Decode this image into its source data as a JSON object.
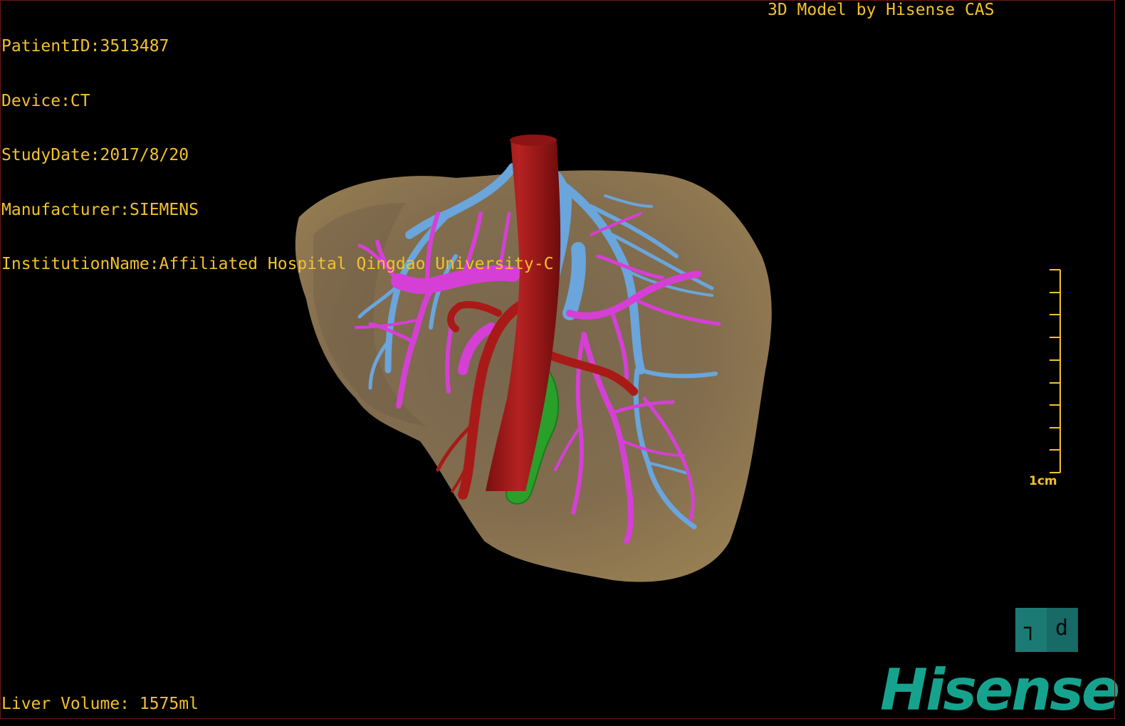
{
  "overlay": {
    "patient_id": "PatientID:3513487",
    "device": "Device:CT",
    "study_date": "StudyDate:2017/8/20",
    "manufacturer": "Manufacturer:SIEMENS",
    "institution": "InstitutionName:Affiliated Hospital Qingdao University-C",
    "credit": "3D Model by Hisense CAS",
    "liver_volume": "Liver Volume: 1575ml"
  },
  "scale_bar": {
    "label": "1cm"
  },
  "orientation_cube": {
    "left_face": "┐",
    "right_face": "d"
  },
  "brand": {
    "logo_text": "Hisense"
  },
  "colors": {
    "overlay_text": "#f2c12e",
    "liver": "#8a7352",
    "hepatic_vein": "#6aa5dc",
    "portal_vein": "#d63fd6",
    "artery": "#a81a18",
    "gallbladder": "#2aa02a",
    "brand": "#16a38e"
  }
}
